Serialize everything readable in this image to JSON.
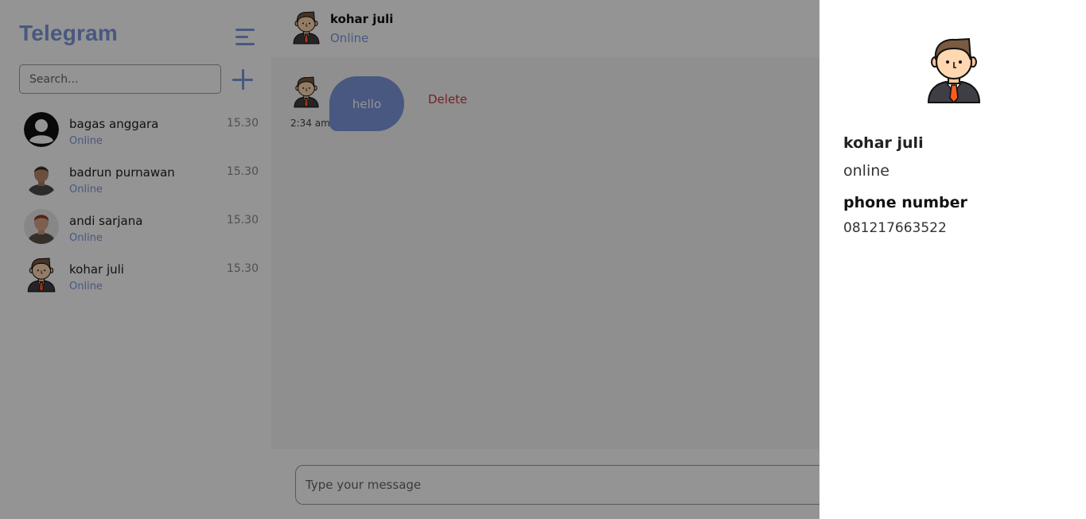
{
  "app": {
    "title": "Telegram"
  },
  "icons": {
    "menu": "menu-lines-icon",
    "add": "plus-icon"
  },
  "colors": {
    "accent": "#7E98DF",
    "delete": "#D2373F"
  },
  "search": {
    "placeholder": "Search..."
  },
  "contacts": [
    {
      "name": "bagas anggara",
      "status": "Online",
      "time": "15.30"
    },
    {
      "name": "badrun purnawan",
      "status": "Online",
      "time": "15.30"
    },
    {
      "name": "andi sarjana",
      "status": "Online",
      "time": "15.30"
    },
    {
      "name": "kohar juli",
      "status": "Online",
      "time": "15.30"
    }
  ],
  "chat": {
    "header": {
      "name": "kohar juli",
      "status": "Online"
    },
    "messages": [
      {
        "text": "hello",
        "time": "2:34 am",
        "delete_label": "Delete"
      }
    ],
    "input_placeholder": "Type your message"
  },
  "profile": {
    "name": "kohar juli",
    "status": "online",
    "phone_label": "phone number",
    "phone": "081217663522"
  }
}
